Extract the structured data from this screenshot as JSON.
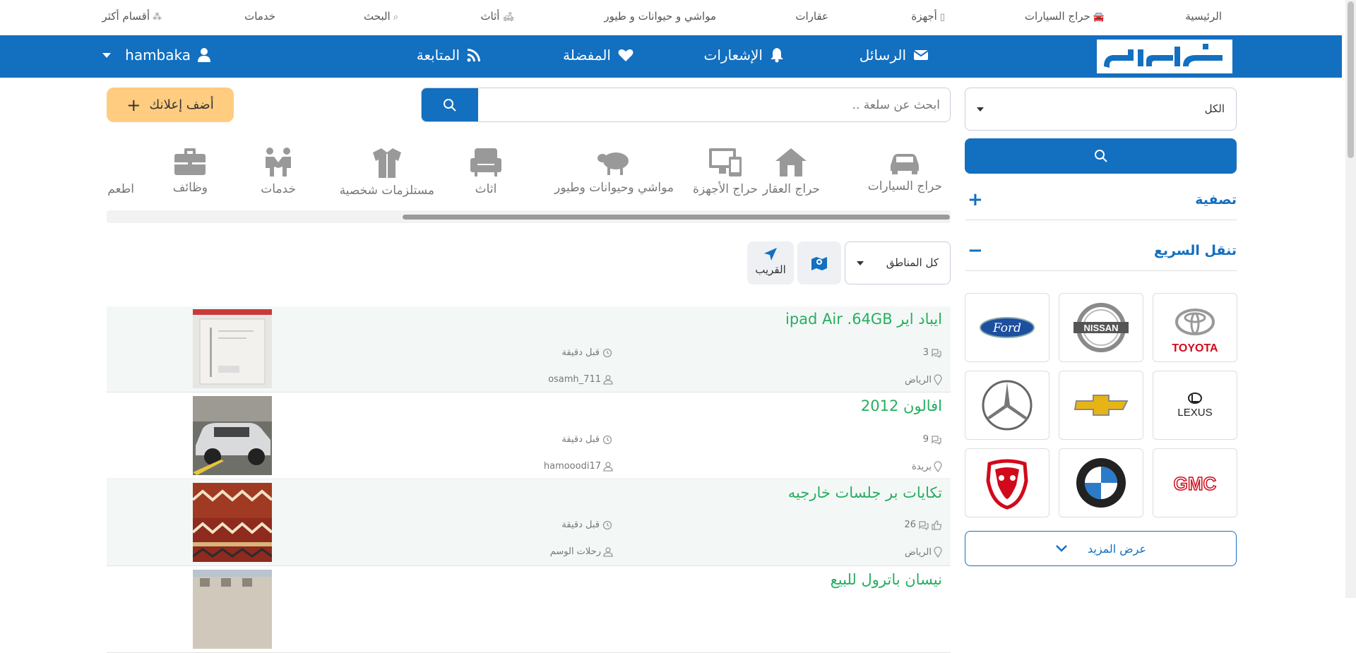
{
  "top_links": [
    {
      "label": "الرئيسية",
      "icon": ""
    },
    {
      "label": "حراج السيارات",
      "icon": "car-icon"
    },
    {
      "label": "أجهزة",
      "icon": "phone-icon"
    },
    {
      "label": "عقارات",
      "icon": ""
    },
    {
      "label": "مواشي و حيوانات و طيور",
      "icon": ""
    },
    {
      "label": "أثاث",
      "icon": "sofa-icon"
    },
    {
      "label": "البحث",
      "icon": "search-icon"
    },
    {
      "label": "خدمات",
      "icon": ""
    },
    {
      "label": "أقسام أكثر",
      "icon": "sitemap-icon"
    }
  ],
  "nav": {
    "logo_text": "حراج",
    "messages": "الرسائل",
    "notifications": "الإشعارات",
    "favorites": "المفضلة",
    "following": "المتابعة",
    "username": "hambaka"
  },
  "sidebar": {
    "category_select": "الكل",
    "filter_label": "تصفية",
    "filter_toggle": "+",
    "quick_nav_label": "تنقل السريع",
    "quick_nav_toggle": "−",
    "brands": [
      {
        "name": "TOYOTA",
        "icon": "toyota-logo"
      },
      {
        "name": "NISSAN",
        "icon": "nissan-logo"
      },
      {
        "name": "Ford",
        "icon": "ford-logo"
      },
      {
        "name": "LEXUS",
        "icon": "lexus-logo"
      },
      {
        "name": "Chevrolet",
        "icon": "chevrolet-logo"
      },
      {
        "name": "Mercedes-Benz",
        "icon": "mercedes-logo"
      },
      {
        "name": "GMC",
        "icon": "gmc-logo"
      },
      {
        "name": "BMW",
        "icon": "bmw-logo"
      },
      {
        "name": "Dodge RAM",
        "icon": "ram-logo"
      }
    ],
    "show_more": "عرض المزيد"
  },
  "search": {
    "placeholder": "ابحث عن سلعة ..",
    "add_ad": "أضف إعلانك"
  },
  "categories": [
    {
      "label": "حراج السيارات",
      "icon": "car-icon"
    },
    {
      "label": "حراج العقار",
      "icon": "house-icon"
    },
    {
      "label": "حراج الأجهزة",
      "icon": "devices-icon"
    },
    {
      "label": "مواشي وحيوانات وطيور",
      "icon": "sheep-icon"
    },
    {
      "label": "اثاث",
      "icon": "armchair-icon"
    },
    {
      "label": "مستلزمات شخصية",
      "icon": "shirt-icon"
    },
    {
      "label": "خدمات",
      "icon": "handshake-icon"
    },
    {
      "label": "وظائف",
      "icon": "briefcase-icon"
    },
    {
      "label": "اطعم",
      "icon": ""
    }
  ],
  "filters": {
    "region": "كل المناطق",
    "nearby": "القريب"
  },
  "listings": [
    {
      "title": "ايباد اير ipad Air .64GB",
      "comments": "3",
      "likes": "",
      "time": "قبل دقيقة",
      "city": "الرياض",
      "user": "osamh_711"
    },
    {
      "title": "افالون 2012",
      "comments": "9",
      "likes": "",
      "time": "قبل دقيقة",
      "city": "بريدة",
      "user": "hamooodi17"
    },
    {
      "title": "تكايات بر جلسات خارجيه",
      "comments": "26",
      "likes": "liked",
      "time": "قبل دقيقة",
      "city": "الرياض",
      "user": "رحلات الوسم"
    },
    {
      "title": "نيسان باترول للبيع",
      "comments": "",
      "likes": "",
      "time": "",
      "city": "",
      "user": ""
    }
  ],
  "colors": {
    "brand_blue": "#136fc0",
    "add_button": "#ffcc80",
    "listing_title": "#27ae60"
  }
}
